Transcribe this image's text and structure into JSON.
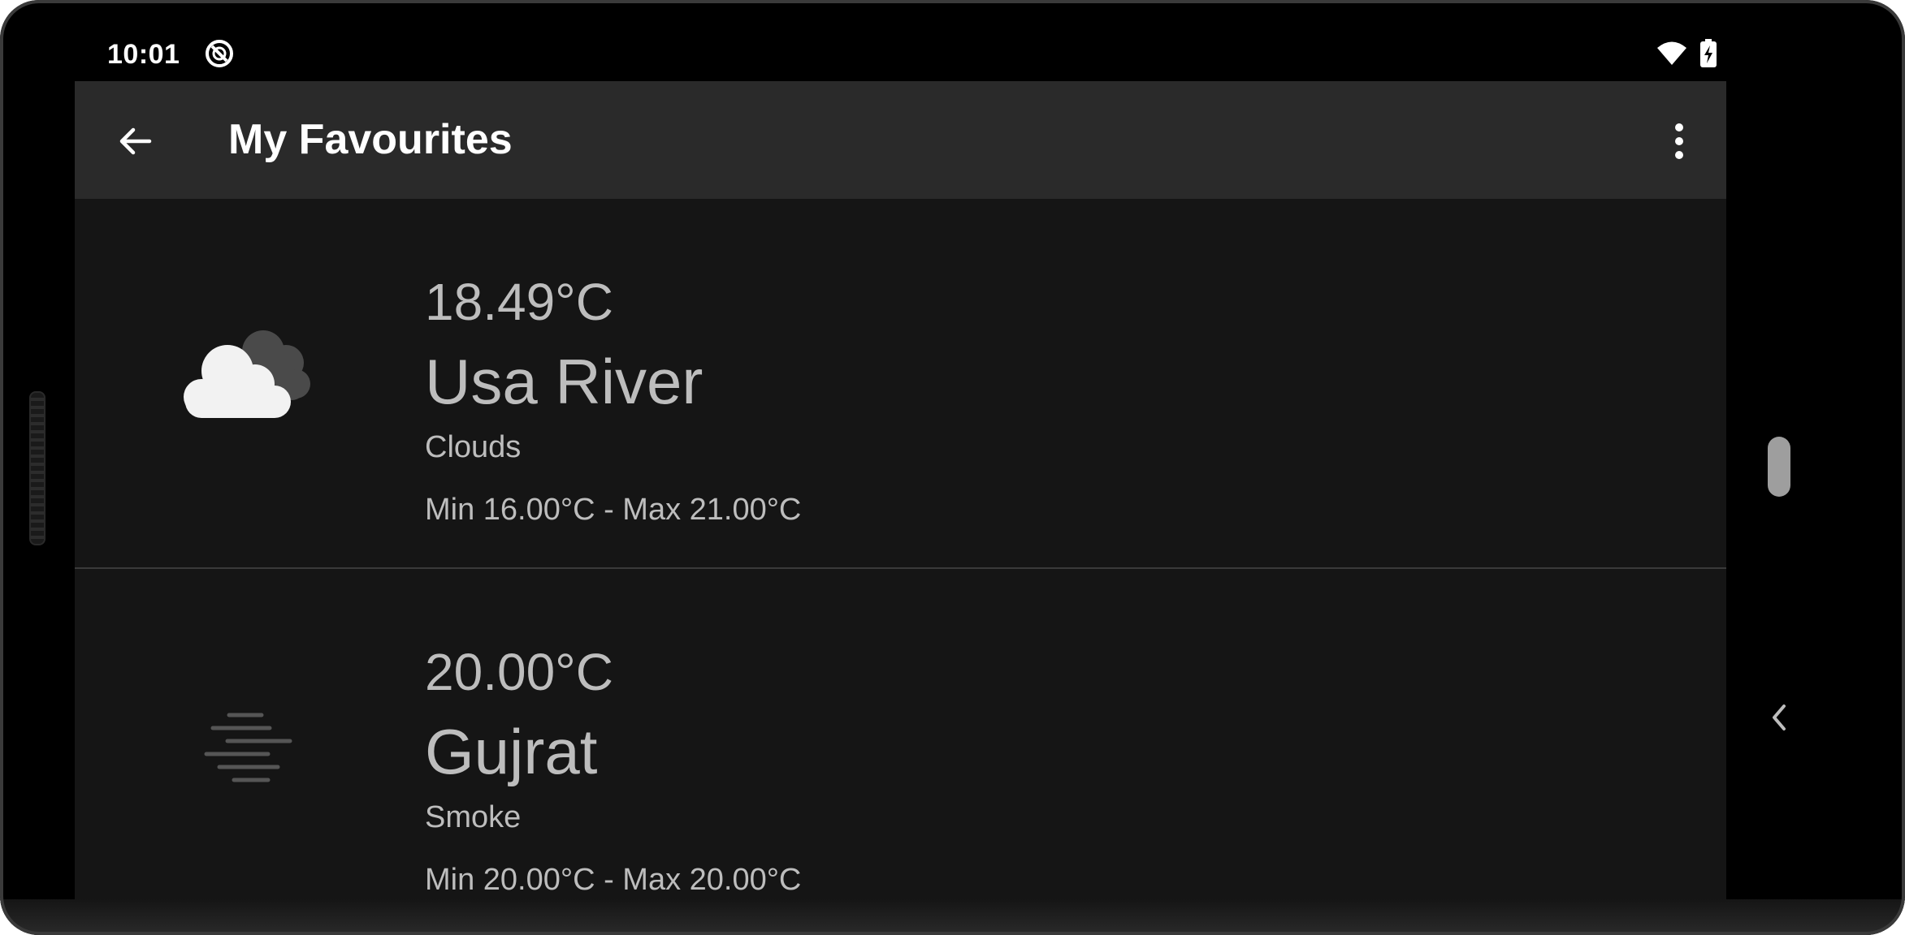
{
  "status_bar": {
    "time": "10:01",
    "dnd_icon": "do-not-disturb-icon",
    "wifi_icon": "wifi-icon",
    "battery_icon": "battery-charging-icon"
  },
  "toolbar": {
    "title": "My Favourites",
    "back_icon": "arrow-back-icon",
    "more_icon": "more-vertical-icon"
  },
  "favourites": [
    {
      "temp": "18.49°C",
      "city": "Usa River",
      "description": "Clouds",
      "minmax": "Min 16.00°C - Max 21.00°C",
      "icon": "clouds-icon"
    },
    {
      "temp": "20.00°C",
      "city": "Gujrat",
      "description": "Smoke",
      "minmax": "Min 20.00°C - Max 20.00°C",
      "icon": "smoke-icon"
    }
  ],
  "colors": {
    "background": "#151515",
    "toolbar": "#2a2a2a",
    "text_primary": "#ffffff",
    "text_secondary": "#bdbdbd"
  }
}
